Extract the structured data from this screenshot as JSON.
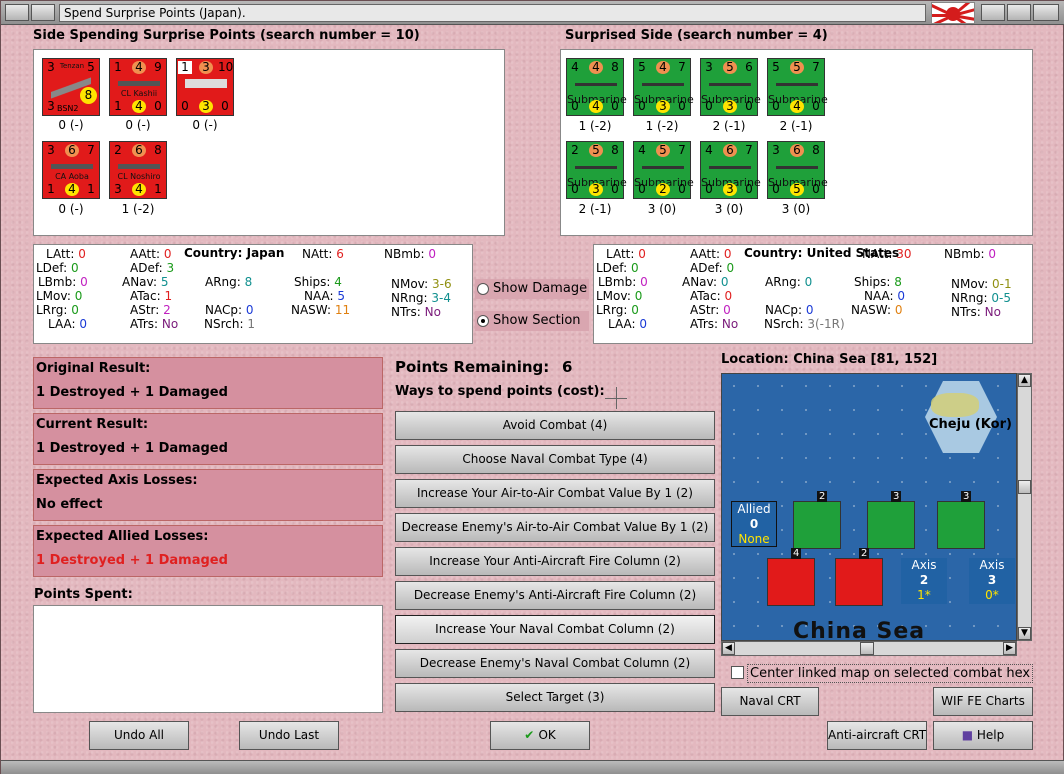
{
  "window": {
    "title": "Spend Surprise Points (Japan)."
  },
  "spending": {
    "header": "Side Spending Surprise Points (search number = 10)",
    "units": [
      {
        "top": [
          "3",
          "Tenzan",
          "5"
        ],
        "mid": "8",
        "bottom": [
          "3",
          "BSN2",
          ""
        ],
        "label": "0 (-)"
      },
      {
        "top": [
          "1",
          "4",
          "9"
        ],
        "name": "CL Kashii",
        "bottom": [
          "1",
          "4",
          "0"
        ],
        "label": "0 (-)"
      },
      {
        "top": [
          "1",
          "3",
          "10"
        ],
        "name": "",
        "bottom": [
          "0",
          "3",
          "0"
        ],
        "label": "0 (-)"
      },
      {
        "top": [
          "3",
          "6",
          "7"
        ],
        "name": "CA Aoba",
        "bottom": [
          "1",
          "4",
          "1"
        ],
        "label": "0 (-)"
      },
      {
        "top": [
          "2",
          "6",
          "8"
        ],
        "name": "CL Noshiro",
        "bottom": [
          "3",
          "4",
          "1"
        ],
        "label": "1 (-2)"
      }
    ]
  },
  "surprised": {
    "header": "Surprised Side (search number = 4)",
    "units": [
      {
        "top": [
          "4",
          "4",
          "8"
        ],
        "name": "Submarine",
        "bottom": [
          "0",
          "4",
          "0"
        ],
        "label": "1 (-2)"
      },
      {
        "top": [
          "5",
          "4",
          "7"
        ],
        "name": "Submarine",
        "bottom": [
          "0",
          "3",
          "0"
        ],
        "label": "1 (-2)"
      },
      {
        "top": [
          "3",
          "5",
          "6"
        ],
        "name": "Submarine",
        "bottom": [
          "0",
          "3",
          "0"
        ],
        "label": "2 (-1)"
      },
      {
        "top": [
          "5",
          "5",
          "7"
        ],
        "name": "Submarine",
        "bottom": [
          "0",
          "4",
          "0"
        ],
        "label": "2 (-1)"
      },
      {
        "top": [
          "2",
          "5",
          "8"
        ],
        "name": "Submarine",
        "bottom": [
          "0",
          "3",
          "0"
        ],
        "label": "2 (-1)"
      },
      {
        "top": [
          "4",
          "5",
          "7"
        ],
        "name": "Submarine",
        "bottom": [
          "0",
          "2",
          "0"
        ],
        "label": "3 (0)"
      },
      {
        "top": [
          "4",
          "6",
          "7"
        ],
        "name": "Submarine",
        "bottom": [
          "0",
          "3",
          "0"
        ],
        "label": "3 (0)"
      },
      {
        "top": [
          "3",
          "6",
          "8"
        ],
        "name": "Submarine",
        "bottom": [
          "0",
          "5",
          "0"
        ],
        "label": "3 (0)"
      }
    ]
  },
  "stats_left": {
    "country_label": "Country:",
    "country": "Japan",
    "LAtt": "0",
    "AAtt": "0",
    "NAtt": "6",
    "NBmb": "0",
    "LDef": "0",
    "ADef": "3",
    "LBmb": "0",
    "ANav": "5",
    "ARng": "8",
    "Ships": "4",
    "NMov": "3-6",
    "LMov": "0",
    "ATac": "1",
    "NAA": "5",
    "NRng": "3-4",
    "LRrg": "0",
    "AStr": "2",
    "NACp": "0",
    "NASW": "11",
    "NTrs": "No",
    "LAA": "0",
    "ATrs": "No",
    "NSrch": "1"
  },
  "stats_right": {
    "country_label": "Country:",
    "country": "United States",
    "LAtt": "0",
    "AAtt": "0",
    "NAtt": "30",
    "NBmb": "0",
    "LDef": "0",
    "ADef": "0",
    "LBmb": "0",
    "ANav": "0",
    "ARng": "0",
    "Ships": "8",
    "NMov": "0-1",
    "LMov": "0",
    "ATac": "0",
    "NAA": "0",
    "NRng": "0-5",
    "LRrg": "0",
    "AStr": "0",
    "NACp": "0",
    "NASW": "0",
    "NTrs": "No",
    "LAA": "0",
    "ATrs": "No",
    "NSrch": "3(-1R)"
  },
  "stat_labels": {
    "LAtt": "LAtt:",
    "AAtt": "AAtt:",
    "NAtt": "NAtt:",
    "NBmb": "NBmb:",
    "LDef": "LDef:",
    "ADef": "ADef:",
    "LBmb": "LBmb:",
    "ANav": "ANav:",
    "ARng": "ARng:",
    "Ships": "Ships:",
    "NMov": "NMov:",
    "LMov": "LMov:",
    "ATac": "ATac:",
    "NAA": "NAA:",
    "NRng": "NRng:",
    "LRrg": "LRrg:",
    "AStr": "AStr:",
    "NACp": "NACp:",
    "NASW": "NASW:",
    "NTrs": "NTrs:",
    "LAA": "LAA:",
    "ATrs": "ATrs:",
    "NSrch": "NSrch:"
  },
  "options": {
    "show_damage": "Show Damage",
    "show_section": "Show Section",
    "selected": "show_section"
  },
  "results": {
    "original_label": "Original Result:",
    "original": "1 Destroyed + 1 Damaged",
    "current_label": "Current Result:",
    "current": "1 Destroyed + 1 Damaged",
    "axis_label": "Expected Axis Losses:",
    "axis": "No effect",
    "allied_label": "Expected Allied Losses:",
    "allied": "1 Destroyed + 1 Damaged",
    "spent_label": "Points Spent:"
  },
  "points": {
    "label": "Points Remaining:",
    "value": "6",
    "ways": "Ways to spend points (cost):"
  },
  "actions": [
    "Avoid Combat (4)",
    "Choose Naval Combat Type (4)",
    "Increase Your Air-to-Air Combat Value By 1 (2)",
    "Decrease Enemy's Air-to-Air Combat Value By 1 (2)",
    "Increase Your Anti-Aircraft Fire Column (2)",
    "Decrease Enemy's Anti-Aircraft Fire Column (2)",
    "Increase Your Naval Combat Column (2)",
    "Decrease Enemy's Naval Combat Column (2)",
    "Select Target (3)"
  ],
  "location": {
    "label": "Location: China Sea [81, 152]",
    "island": "Cheju (Kor)",
    "sea": "China Sea",
    "allied": {
      "title": "Allied",
      "value": "0",
      "sub": "None"
    },
    "axis1": {
      "title": "Axis",
      "value": "2",
      "sub": "1*"
    },
    "axis2": {
      "title": "Axis",
      "value": "3",
      "sub": "0*"
    },
    "stack_counts": [
      "2",
      "3",
      "3",
      "4",
      "2"
    ]
  },
  "center_map": "Center linked map on selected combat hex",
  "buttons": {
    "naval_crt": "Naval CRT",
    "wif_fe": "WIF FE Charts",
    "aa_crt": "Anti-aircraft CRT",
    "help": "Help",
    "undo_all": "Undo All",
    "undo_last": "Undo Last",
    "ok": "OK"
  },
  "colors": {
    "japan_unit": "#e11a1a",
    "us_unit": "#1fa03a",
    "allied_losses": "#e02020"
  }
}
